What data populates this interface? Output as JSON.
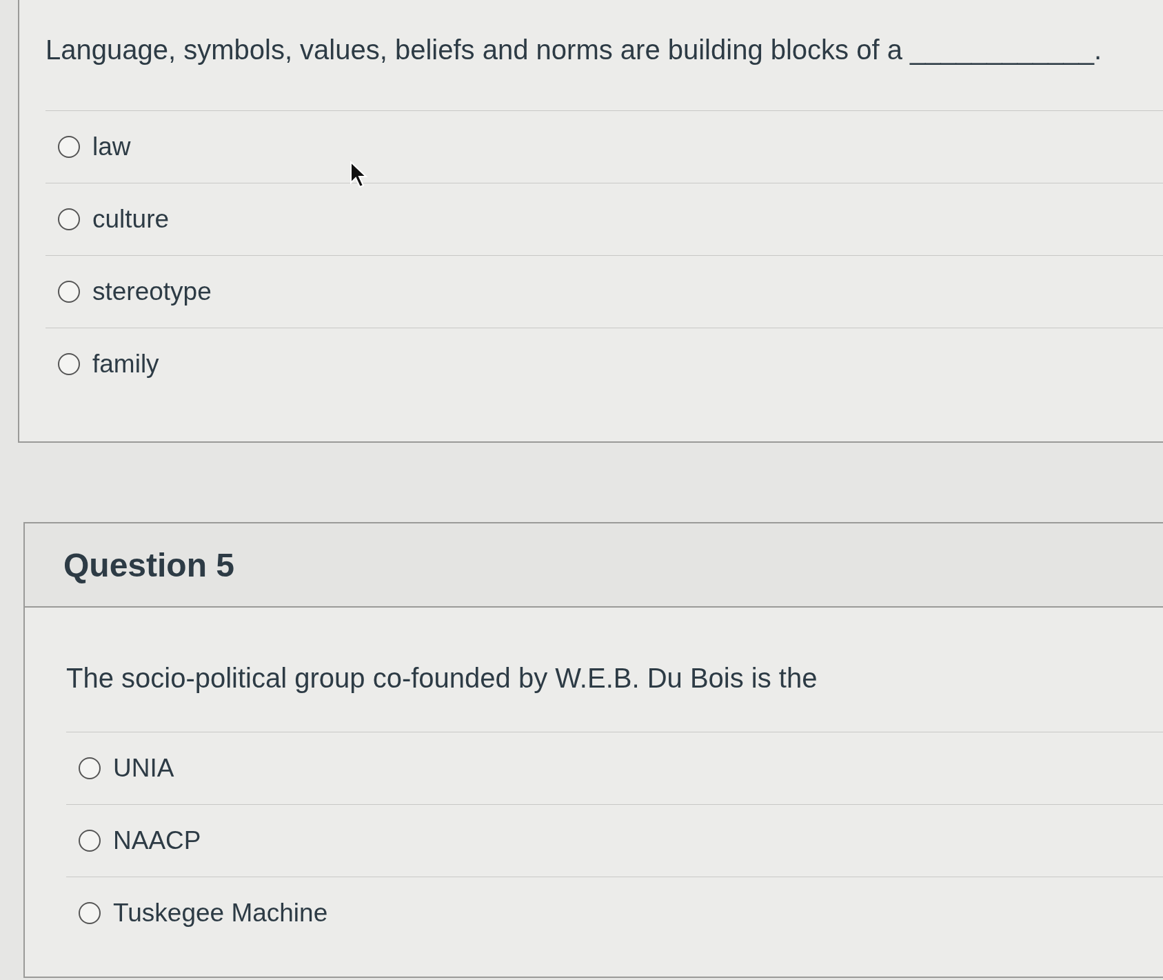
{
  "questions": [
    {
      "text": "Language, symbols, values, beliefs and norms are building blocks of a ____________.",
      "options": [
        {
          "label": "law",
          "selected": false
        },
        {
          "label": "culture",
          "selected": false
        },
        {
          "label": "stereotype",
          "selected": false
        },
        {
          "label": "family",
          "selected": false
        }
      ]
    },
    {
      "title": "Question 5",
      "text": "The socio-political group co-founded by W.E.B. Du Bois is the",
      "options": [
        {
          "label": "UNIA",
          "selected": false
        },
        {
          "label": "NAACP",
          "selected": false
        },
        {
          "label": "Tuskegee Machine",
          "selected": false
        }
      ]
    }
  ]
}
